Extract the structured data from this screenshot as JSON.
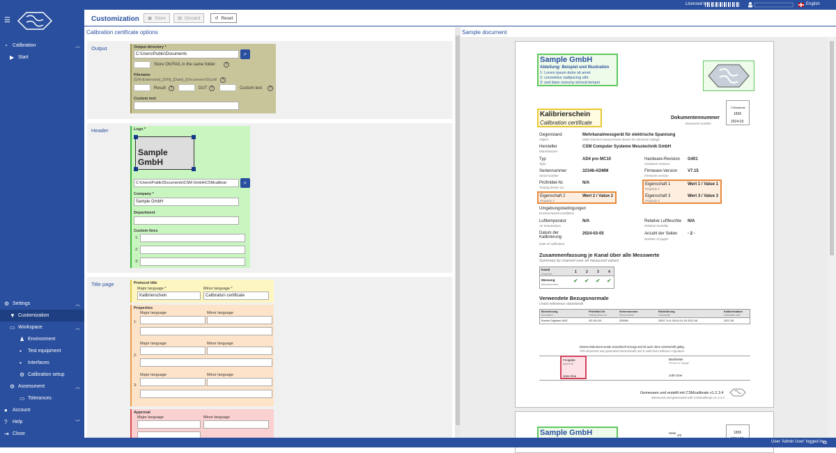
{
  "topbar": {
    "license": "Licensed to",
    "language": "English"
  },
  "sidebar": {
    "items": [
      {
        "label": "Calibration",
        "icon": "gauge-icon"
      },
      {
        "label": "Start",
        "icon": "play-icon"
      },
      {
        "label": "Settings",
        "icon": "gear-icon"
      },
      {
        "label": "Customization",
        "icon": "stamp-icon"
      },
      {
        "label": "Workspace",
        "icon": "workspace-icon"
      },
      {
        "label": "Environment",
        "icon": "person-icon"
      },
      {
        "label": "Test equipment",
        "icon": "equipment-icon"
      },
      {
        "label": "Interfaces",
        "icon": "interface-icon"
      },
      {
        "label": "Calibration setup",
        "icon": "setup-icon"
      },
      {
        "label": "Assessment",
        "icon": "assessment-icon"
      },
      {
        "label": "Tolerances",
        "icon": "tolerance-icon"
      },
      {
        "label": "Account",
        "icon": "account-icon"
      },
      {
        "label": "Help",
        "icon": "help-icon"
      },
      {
        "label": "Close",
        "icon": "close-icon"
      }
    ]
  },
  "header": {
    "title": "Customization",
    "store": "Store",
    "discard": "Discard",
    "reset": "Reset"
  },
  "left": {
    "title": "Calibration certificate options",
    "output": {
      "label": "Output",
      "dir_label": "Output directory *",
      "dir_value": "C:\\Users\\Public\\Documents",
      "same_folder": "Store OK/FAIL in the same folder",
      "filename_label": "Filename",
      "filename_value": "[S/N-Extension]_[S/N]_[Date]_[Document-ID].pdf",
      "result": "Result",
      "dut": "DUT",
      "custom_text": "Custom text",
      "custom_text_label": "Custom text"
    },
    "header": {
      "label": "Header",
      "logo_label": "Logo *",
      "logo_text": "Sample GmbH",
      "logo_path": "C:\\Users\\Public\\Documents\\CSM GmbH\\CSMcalibrat",
      "company_label": "Company *",
      "company_value": "Sample GmbH",
      "department_label": "Department",
      "custom_lines_label": "Custom lines",
      "lines": [
        "1:",
        "2:",
        "3:"
      ]
    },
    "title_page": {
      "label": "Title page",
      "protocol_title": "Protocol title",
      "major_lang": "Major language *",
      "minor_lang": "Minor language *",
      "major_value": "Kalibrierschein",
      "minor_value": "Calibration certificate",
      "properties": "Properties",
      "major": "Major language",
      "minor": "Minor language",
      "prop_nums": [
        "1:",
        "2:",
        "3:"
      ],
      "approval": "Approval"
    }
  },
  "right": {
    "title": "Sample document",
    "doc": {
      "company": "Sample GmbH",
      "dept": "Abteilung: Beispiel und Illustration",
      "lines": [
        "1: Lorem ipsum dolor sit amet",
        "2: consetetur sadipscing elitr",
        "3: sed diam nonumy eirmod tempor"
      ],
      "title_de": "Kalibrierschein",
      "title_en": "Calibration certificate",
      "docnum_de": "Dokumentennummer",
      "docnum_en": "Document number",
      "csm": "CSMcalibrate",
      "num1": "1836",
      "num2": "2024-03",
      "rows": [
        {
          "k": "Gegenstand",
          "ke": "Object",
          "v": "Mehrkanalmessgerät für elektrische Spannung",
          "ve": "Multi-channel measurement device for electrical voltage"
        },
        {
          "k": "Hersteller",
          "ke": "Manufacturer",
          "v": "CSM Computer Systeme Messtechnik GmbH"
        },
        {
          "k": "Typ",
          "ke": "Type",
          "v": "AD4 pro MC10",
          "k2": "Hardware-Revision",
          "ke2": "Hardware revision",
          "v2": "G401"
        },
        {
          "k": "Seriennummer",
          "ke": "Serial number",
          "v": "32348-ADMM",
          "k2": "Firmware-Version",
          "ke2": "Firmware version",
          "v2": "V7.15"
        },
        {
          "k": "Prüfmittel-Nr.",
          "ke": "Testing device no.",
          "v": "N/A",
          "k2": "Eigenschaft 1",
          "ke2": "Property 1",
          "v2": "Wert 1 / Value 1"
        },
        {
          "k": "Eigenschaft 2",
          "ke": "Property 2",
          "v": "Wert 2 / Value 2",
          "k2": "Eigenschaft 3",
          "ke2": "Property 3",
          "v2": "Wert 3 / Value 3"
        },
        {
          "k": "Umgebungsbedingungen",
          "ke": "Environmental conditions"
        },
        {
          "k": "Lufttemperatur",
          "ke": "Air temperature",
          "v": "N/A",
          "k2": "Relative Luftfeuchte",
          "ke2": "Relative humidity",
          "v2": "N/A"
        },
        {
          "k": "Datum der Kalibrierung",
          "ke": "Date of calibration",
          "v": "2024-03-05",
          "k2": "Anzahl der Seiten",
          "ke2": "Number of pages",
          "v2": "- 2 -"
        }
      ],
      "summary_de": "Zusammenfassung je Kanal über alle Messwerte",
      "summary_en": "Summary by channel over all measured values",
      "kanal": "Kanal",
      "channel": "Channel",
      "messung": "Messung",
      "measurement": "Measurement",
      "channels": [
        "1",
        "2",
        "3",
        "4"
      ],
      "ref_de": "Verwendete Bezugsnormale",
      "ref_en": "Used reference standards",
      "ref_cols": [
        "Bezeichnung",
        "Prüfmittel-Nr.",
        "Seriennummer",
        "Rückführung",
        "Kalibrierdatum"
      ],
      "ref_cols_en": [
        "Description",
        "Testing device no.",
        "Serial number",
        "Traceability",
        "Calibration date"
      ],
      "ref_row": [
        "Burster Digistant 4462",
        "SG-90.01K",
        "253989",
        "29517 D-K-15141-01-00 2022-08",
        "2022-08"
      ],
      "note_de": "Dieses Dokument wurde maschinell erzeugt und ist auch ohne Unterschrift gültig.",
      "note_en": "This document was generated electronically and is valid even without a signature.",
      "freigabe": "Freigabe",
      "approval": "Approval",
      "bearbeiter": "Bearbeiter",
      "in_charge": "Person in charge",
      "signer1": "Jane Doe",
      "signer2": "John Doe",
      "footer_de": "Gemessen und erstellt mit CSMcalibrate v1.2.3.4",
      "footer_en": "Measured and generated with CSMcalibrate v1.2.3.4",
      "p2_company": "Sample GmbH",
      "p2_seite": "Seite",
      "p2_page": "2/2",
      "p2_num": "1836",
      "p2_date": "2024-03"
    }
  },
  "status": {
    "text": "User 'Admin User' logged in"
  },
  "colors": {
    "brand": "#2a4f9e",
    "output_bg": "#c9c59a",
    "header_bg": "#c9f5c0",
    "title_bg": "#fdf6c0",
    "props_bg": "#fde3c8",
    "approval_bg": "#fbd0d0"
  }
}
